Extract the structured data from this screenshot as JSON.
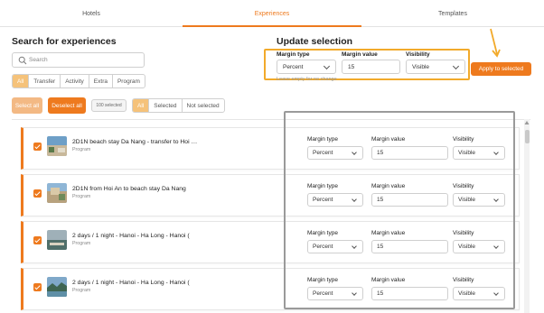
{
  "tabs": [
    {
      "label": "Hotels"
    },
    {
      "label": "Experiences"
    },
    {
      "label": "Templates"
    }
  ],
  "search": {
    "title": "Search for experiences",
    "placeholder": "Search",
    "type_filters": [
      "All",
      "Transfer",
      "Activity",
      "Extra",
      "Program"
    ],
    "select_all": "Select all",
    "deselect_all": "Deselect all",
    "selected_count": "100 selected",
    "selection_filters": [
      "All",
      "Selected",
      "Not selected"
    ]
  },
  "update": {
    "title": "Update selection",
    "margin_type_label": "Margin type",
    "margin_value_label": "Margin value",
    "visibility_label": "Visibility",
    "margin_type": "Percent",
    "margin_value": "15",
    "visibility": "Visible",
    "hint": "Leave empty for no change",
    "apply": "Apply to selected"
  },
  "row_labels": {
    "margin_type": "Margin type",
    "margin_value": "Margin value",
    "visibility": "Visibility"
  },
  "rows": [
    {
      "title": "2D1N beach stay Da Nang - transfer to Hoi …",
      "type": "Program",
      "margin_type": "Percent",
      "margin_value": "15",
      "visibility": "Visible"
    },
    {
      "title": "2D1N from Hoi An to beach stay Da Nang",
      "type": "Program",
      "margin_type": "Percent",
      "margin_value": "15",
      "visibility": "Visible"
    },
    {
      "title": "2 days / 1 night - Hanoi - Ha Long - Hanoi (",
      "type": "Program",
      "margin_type": "Percent",
      "margin_value": "15",
      "visibility": "Visible"
    },
    {
      "title": "2 days / 1 night - Hanoi - Ha Long - Hanoi (",
      "type": "Program",
      "margin_type": "Percent",
      "margin_value": "15",
      "visibility": "Visible"
    }
  ],
  "colors": {
    "accent": "#ee7a1e",
    "highlight_orange": "#f2aa2b",
    "highlight_gray": "#9a9a9a"
  }
}
